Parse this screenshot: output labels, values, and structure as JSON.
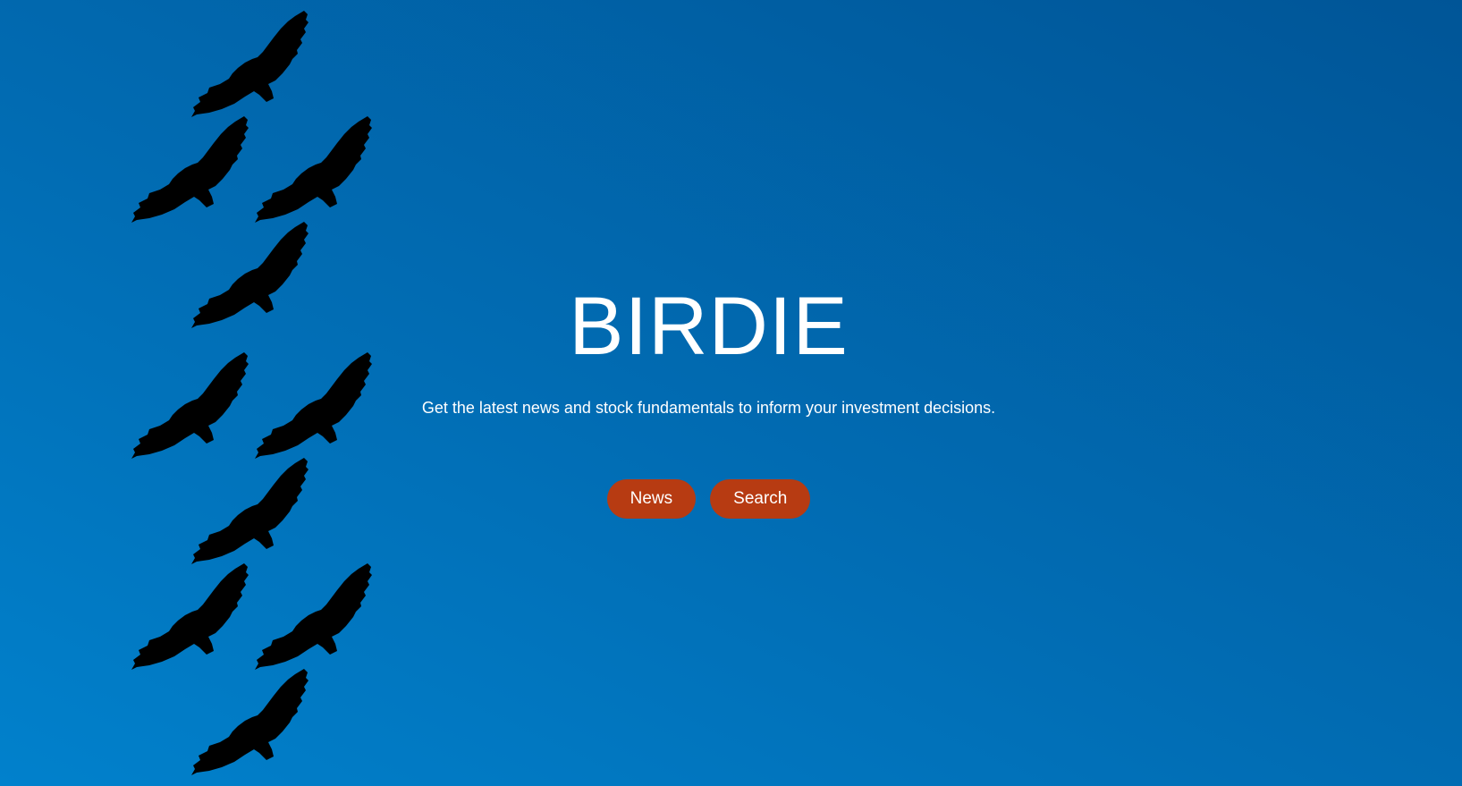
{
  "decor": {
    "icon": "eagle-silhouette-icon",
    "color": "#000000"
  },
  "hero": {
    "title": "BIRDIE",
    "subtitle": "Get the latest news and stock fundamentals to inform your investment decisions."
  },
  "nav": {
    "news_label": "News",
    "search_label": "Search"
  },
  "colors": {
    "background_start": "#0181cc",
    "background_end": "#005597",
    "button": "#b73b12",
    "text": "#ffffff"
  }
}
